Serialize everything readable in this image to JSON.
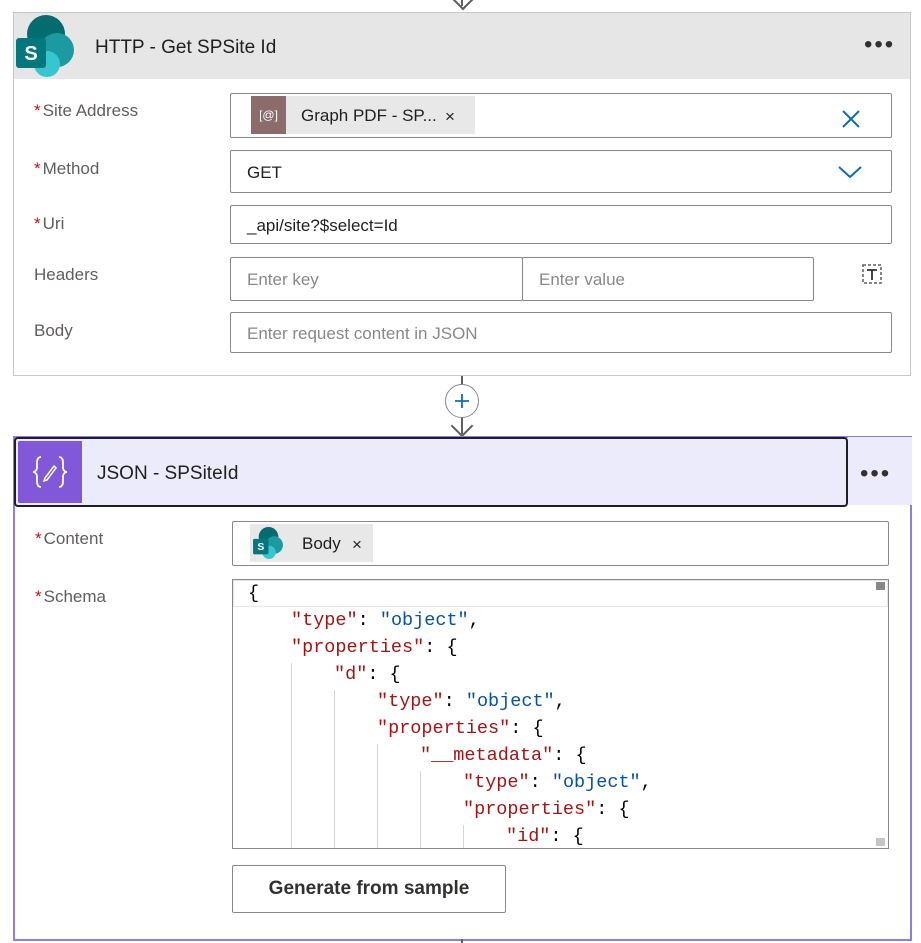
{
  "http_card": {
    "title": "HTTP - Get SPSite Id",
    "more_label": "•••",
    "icon": "sharepoint-icon",
    "fields": {
      "site_address": {
        "label": "Site Address",
        "required_mark": "*",
        "token_icon_text": "[@]",
        "token_label": "Graph PDF - SP...",
        "token_remove": "×",
        "clear_icon": "close-icon"
      },
      "method": {
        "label": "Method",
        "required_mark": "*",
        "value": "GET",
        "dropdown_icon": "chevron-down-icon"
      },
      "uri": {
        "label": "Uri",
        "required_mark": "*",
        "value": "_api/site?$select=Id"
      },
      "headers": {
        "label": "Headers",
        "key_placeholder": "Enter key",
        "value_placeholder": "Enter value",
        "switch_icon": "text-mode-icon"
      },
      "body": {
        "label": "Body",
        "placeholder": "Enter request content in JSON"
      }
    }
  },
  "connector": {
    "add_icon": "plus-icon",
    "add_symbol": "+"
  },
  "json_card": {
    "title": "JSON - SPSiteId",
    "more_label": "•••",
    "icon": "json-pencil-icon",
    "badge_text": "{✎}",
    "content": {
      "label": "Content",
      "required_mark": "*",
      "token_label": "Body",
      "token_remove": "×",
      "token_icon": "sharepoint-icon"
    },
    "schema": {
      "label": "Schema",
      "required_mark": "*",
      "lines": [
        {
          "indent": 0,
          "parts": [
            {
              "t": "{",
              "c": ""
            }
          ]
        },
        {
          "indent": 1,
          "parts": [
            {
              "t": "\"type\"",
              "c": "k"
            },
            {
              "t": ": ",
              "c": ""
            },
            {
              "t": "\"object\"",
              "c": "s"
            },
            {
              "t": ",",
              "c": ""
            }
          ]
        },
        {
          "indent": 1,
          "parts": [
            {
              "t": "\"properties\"",
              "c": "k"
            },
            {
              "t": ": {",
              "c": ""
            }
          ]
        },
        {
          "indent": 2,
          "parts": [
            {
              "t": "\"d\"",
              "c": "k"
            },
            {
              "t": ": {",
              "c": ""
            }
          ]
        },
        {
          "indent": 3,
          "parts": [
            {
              "t": "\"type\"",
              "c": "k"
            },
            {
              "t": ": ",
              "c": ""
            },
            {
              "t": "\"object\"",
              "c": "s"
            },
            {
              "t": ",",
              "c": ""
            }
          ]
        },
        {
          "indent": 3,
          "parts": [
            {
              "t": "\"properties\"",
              "c": "k"
            },
            {
              "t": ": {",
              "c": ""
            }
          ]
        },
        {
          "indent": 4,
          "parts": [
            {
              "t": "\"__metadata\"",
              "c": "k"
            },
            {
              "t": ": {",
              "c": ""
            }
          ]
        },
        {
          "indent": 5,
          "parts": [
            {
              "t": "\"type\"",
              "c": "k"
            },
            {
              "t": ": ",
              "c": ""
            },
            {
              "t": "\"object\"",
              "c": "s"
            },
            {
              "t": ",",
              "c": ""
            }
          ]
        },
        {
          "indent": 5,
          "parts": [
            {
              "t": "\"properties\"",
              "c": "k"
            },
            {
              "t": ": {",
              "c": ""
            }
          ]
        },
        {
          "indent": 6,
          "parts": [
            {
              "t": "\"id\"",
              "c": "k"
            },
            {
              "t": ": {",
              "c": ""
            }
          ]
        }
      ]
    },
    "generate_button": "Generate from sample"
  }
}
